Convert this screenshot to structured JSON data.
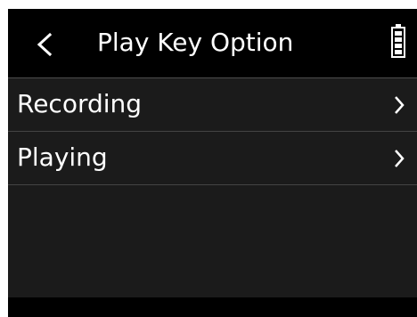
{
  "header": {
    "title": "Play Key Option",
    "back_icon": "chevron-left-icon",
    "battery_icon": "battery-full-icon"
  },
  "menu": {
    "items": [
      {
        "label": "Recording",
        "icon": "chevron-right-icon"
      },
      {
        "label": "Playing",
        "icon": "chevron-right-icon"
      }
    ]
  },
  "colors": {
    "background": "#000000",
    "list_background": "#1b1b1b",
    "divider": "#444444",
    "text": "#ffffff"
  }
}
